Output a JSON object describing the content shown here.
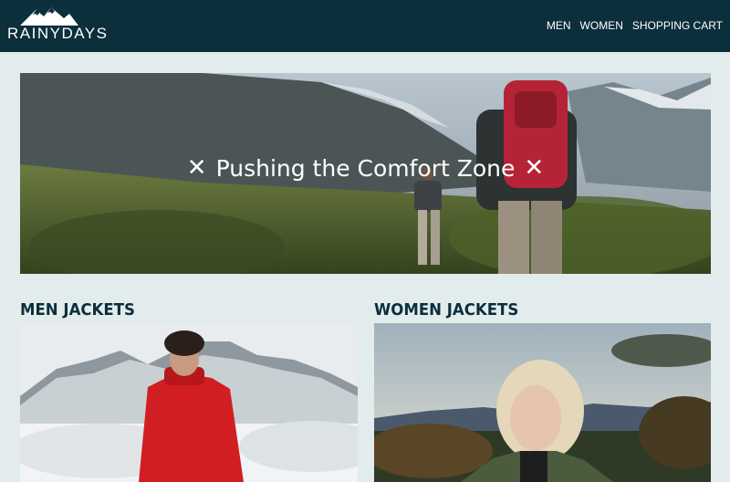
{
  "brand": {
    "name": "RAINYDAYS"
  },
  "nav": {
    "items": [
      {
        "label": "MEN"
      },
      {
        "label": "WOMEN"
      },
      {
        "label": "SHOPPING CART"
      }
    ]
  },
  "hero": {
    "title": "Pushing the Comfort Zone",
    "left_mark": "✕",
    "right_mark": "✕"
  },
  "sections": [
    {
      "title": "MEN JACKETS"
    },
    {
      "title": "WOMEN JACKETS"
    }
  ],
  "colors": {
    "header_bg": "#0b2f3b",
    "page_bg": "#e3ecec",
    "heading": "#0b2f3b"
  }
}
